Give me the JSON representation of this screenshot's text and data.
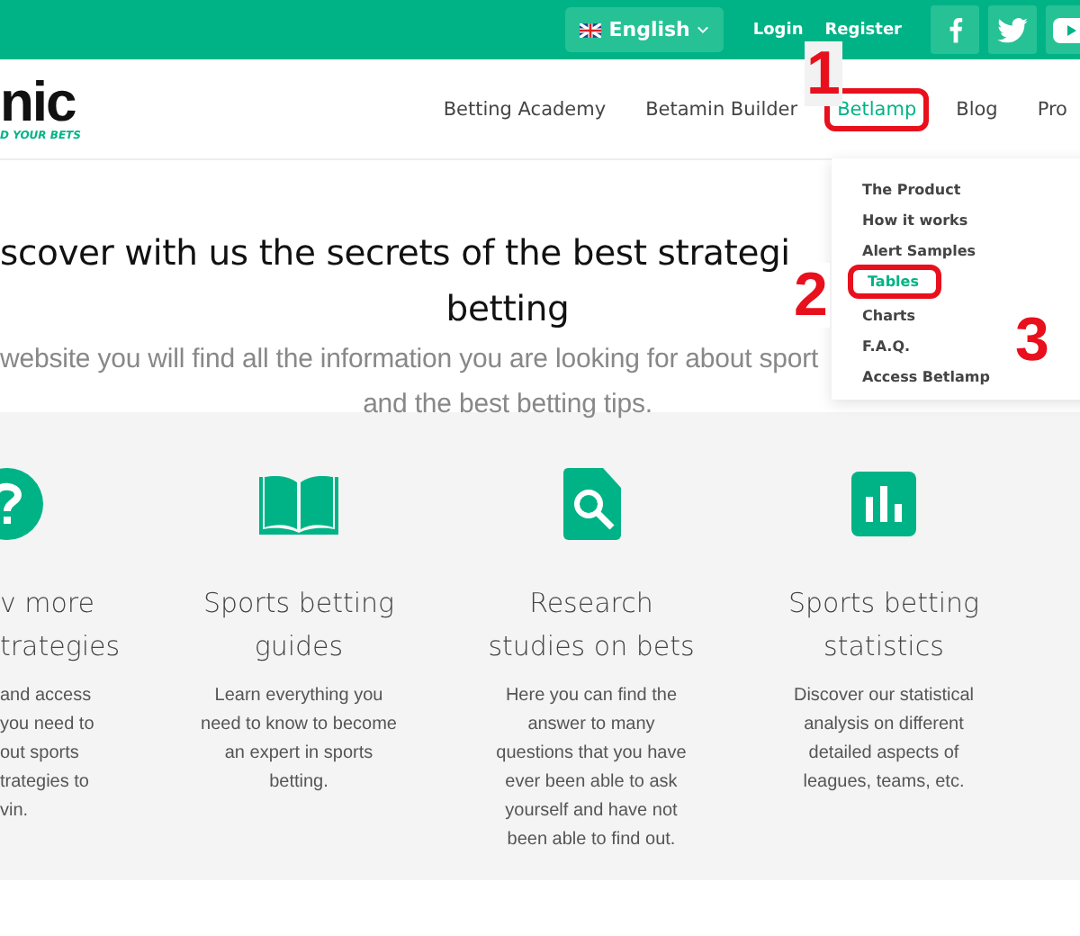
{
  "top_bar": {
    "language": "English",
    "links": [
      "Login",
      "Register"
    ],
    "social": [
      {
        "kind": "facebook"
      },
      {
        "kind": "twitter"
      },
      {
        "kind": "youtube"
      }
    ]
  },
  "logo": {
    "name": "nic",
    "tagline": "D YOUR BETS"
  },
  "nav": [
    {
      "label": "Betting Academy",
      "selected": false,
      "highlighted": false
    },
    {
      "label": "Betamin Builder",
      "selected": false,
      "highlighted": false
    },
    {
      "label": "Betlamp",
      "selected": true,
      "highlighted": true
    },
    {
      "label": "Blog",
      "selected": false,
      "highlighted": false
    },
    {
      "label": "Pro",
      "selected": false,
      "highlighted": false
    }
  ],
  "dropdown": [
    {
      "label": "The Product",
      "selected": false,
      "highlighted": false
    },
    {
      "label": "How it works",
      "selected": false,
      "highlighted": false
    },
    {
      "label": "Alert Samples",
      "selected": false,
      "highlighted": false
    },
    {
      "label": "Tables",
      "selected": true,
      "highlighted": true
    },
    {
      "label": "Charts",
      "selected": false,
      "highlighted": false
    },
    {
      "label": "F.A.Q.",
      "selected": false,
      "highlighted": false
    },
    {
      "label": "Access Betlamp",
      "selected": false,
      "highlighted": false
    }
  ],
  "hero": {
    "heading": [
      "scover with us the secrets of the best strategi",
      "betting"
    ],
    "subtitle": [
      "website you will find all the information you are looking for about sport",
      "and the best betting tips."
    ]
  },
  "features": [
    {
      "kind": "clipped",
      "title": [
        "v more",
        "trategies"
      ],
      "text": [
        "and access",
        "you need to",
        "out sports",
        "trategies to",
        "vin."
      ]
    },
    {
      "kind": "full",
      "title": [
        "Sports betting",
        "guides"
      ],
      "text": [
        "Learn everything you",
        "need to know to become",
        "an expert in sports",
        "betting."
      ]
    },
    {
      "kind": "full",
      "title": [
        "Research",
        "studies on bets"
      ],
      "text": [
        "Here you can find the",
        "answer to many",
        "questions that you have",
        "ever been able to ask",
        "yourself and have not",
        "been able to find out."
      ]
    },
    {
      "kind": "full",
      "title": [
        "Sports betting",
        "statistics"
      ],
      "text": [
        "Discover our statistical",
        "analysis on different",
        "detailed aspects of",
        "leagues, teams, etc."
      ]
    }
  ],
  "annotations": [
    {
      "label": "1"
    },
    {
      "label": "2"
    },
    {
      "label": "3"
    }
  ]
}
